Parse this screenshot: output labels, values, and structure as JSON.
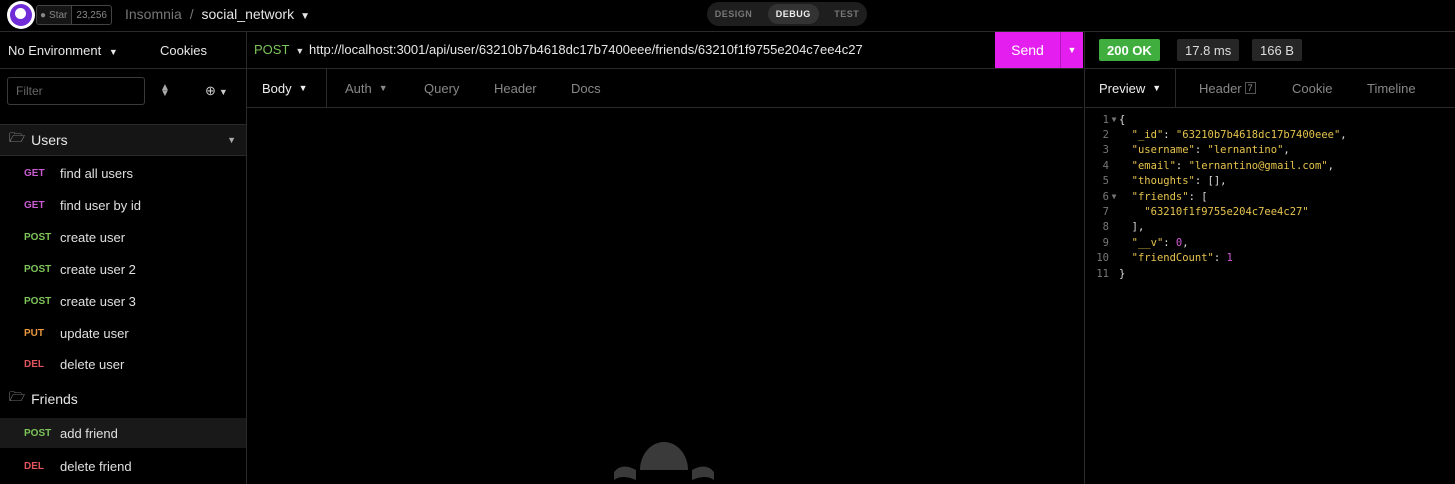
{
  "app": {
    "github": {
      "star_label": "Star",
      "star_count": "23,256"
    },
    "breadcrumb": {
      "workspace": "Insomnia",
      "separator": "/",
      "project": "social_network"
    },
    "modes": [
      "DESIGN",
      "DEBUG",
      "TEST"
    ],
    "active_mode": "DEBUG"
  },
  "sidebar": {
    "environment": "No Environment",
    "cookies": "Cookies",
    "filter_placeholder": "Filter",
    "folders": [
      {
        "name": "Users",
        "requests": [
          {
            "method": "GET",
            "name": "find all users"
          },
          {
            "method": "GET",
            "name": "find user by id"
          },
          {
            "method": "POST",
            "name": "create user"
          },
          {
            "method": "POST",
            "name": "create user 2"
          },
          {
            "method": "POST",
            "name": "create user 3"
          },
          {
            "method": "PUT",
            "name": "update user"
          },
          {
            "method": "DEL",
            "name": "delete user"
          }
        ]
      },
      {
        "name": "Friends",
        "requests": [
          {
            "method": "POST",
            "name": "add friend",
            "selected": true
          },
          {
            "method": "DEL",
            "name": "delete friend"
          }
        ]
      }
    ]
  },
  "method_colors": {
    "GET": "#c95bd1",
    "POST": "#7dc45a",
    "PUT": "#e89a3c",
    "DEL": "#e0545e"
  },
  "request": {
    "method": "POST",
    "url": "http://localhost:3001/api/user/63210b7b4618dc17b7400eee/friends/63210f1f9755e204c7ee4c27",
    "send_label": "Send",
    "tabs": [
      "Body",
      "Auth",
      "Query",
      "Header",
      "Docs"
    ],
    "active_tab": "Body"
  },
  "response": {
    "status": "200 OK",
    "time": "17.8 ms",
    "size": "166 B",
    "tabs": {
      "preview": "Preview",
      "header": "Header",
      "header_count": "7",
      "cookie": "Cookie",
      "timeline": "Timeline"
    },
    "lines": [
      "{",
      "  \"_id\": \"63210b7b4618dc17b7400eee\",",
      "  \"username\": \"lernantino\",",
      "  \"email\": \"lernantino@gmail.com\",",
      "  \"thoughts\": [],",
      "  \"friends\": [",
      "    \"63210f1f9755e204c7ee4c27\"",
      "  ],",
      "  \"__v\": 0,",
      "  \"friendCount\": 1",
      "}"
    ]
  },
  "colors": {
    "accent": "#e51ef0",
    "status_ok": "#3fae3f",
    "brand": "#6f2cd7"
  }
}
